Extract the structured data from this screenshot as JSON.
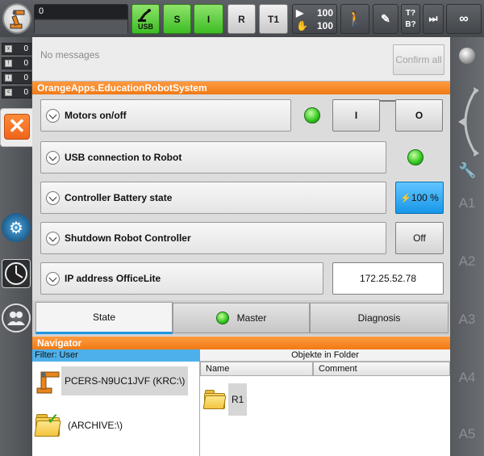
{
  "topbar": {
    "status_value": "0",
    "usb_label": "USB",
    "s_label": "S",
    "i_label": "I",
    "r_label": "R",
    "t1_label": "T1",
    "override_prog": "100",
    "override_jog": "100",
    "t_label": "T?",
    "b_label": "B?",
    "infinity_label": "∞"
  },
  "message_counts": [
    "0",
    "0",
    "0",
    "0"
  ],
  "messages": {
    "empty_text": "No messages",
    "confirm_all": "Confirm all"
  },
  "app": {
    "title": "OrangeApps.EducationRobotSystem",
    "rows": [
      {
        "label": "Motors on/off",
        "on_label": "I",
        "off_label": "O"
      },
      {
        "label": "USB connection to Robot"
      },
      {
        "label": "Controller Battery state",
        "value": "100 %"
      },
      {
        "label": "Shutdown Robot Controller",
        "button": "Off"
      },
      {
        "label": "IP address OfficeLite",
        "value": "172.25.52.78"
      }
    ],
    "status_led_color": "#2fc51e"
  },
  "tabs": [
    {
      "label": "State",
      "active": true
    },
    {
      "label": "Master"
    },
    {
      "label": "Diagnosis"
    }
  ],
  "navigator": {
    "title": "Navigator",
    "filter": "Filter: User",
    "tree": [
      {
        "label": "PCERS-N9UC1JVF (KRC:\\)"
      },
      {
        "label": "(ARCHIVE:\\)"
      }
    ],
    "files_title": "Objekte in Folder",
    "columns": [
      "Name",
      "Comment"
    ],
    "files": [
      {
        "name": "R1"
      }
    ]
  },
  "right_axes": [
    "A1",
    "A2",
    "A3",
    "A4",
    "A5"
  ],
  "colors": {
    "accent_orange": "#f07a14",
    "accent_blue": "#1e98e0",
    "status_green": "#3dbd24"
  }
}
